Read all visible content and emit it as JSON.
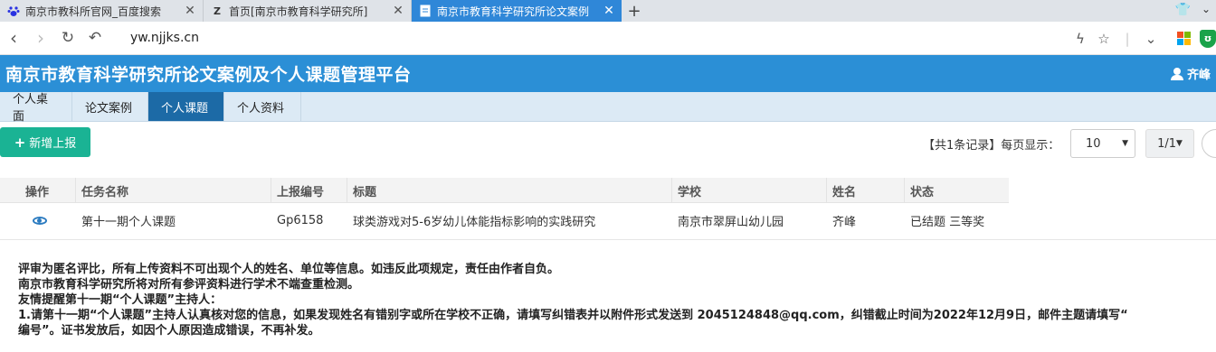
{
  "browser": {
    "tabs": [
      {
        "title": "南京市教科所官网_百度搜索",
        "icon": "baidu-paw-icon"
      },
      {
        "title": "首页[南京市教育科学研究所]",
        "icon": "z-logo-icon"
      },
      {
        "title": "南京市教育科学研究所论文案例",
        "icon": "document-icon",
        "active": true
      }
    ],
    "url": "yw.njjks.cn"
  },
  "app": {
    "title": "南京市教育科学研究所论文案例及个人课题管理平台",
    "user": "齐峰",
    "accent": "#2b8fd6"
  },
  "nav": {
    "tabs": [
      "个人桌面",
      "论文案例",
      "个人课题",
      "个人资料"
    ],
    "active": "个人课题"
  },
  "toolbar": {
    "add_label": "新增上报",
    "records": "【共1条记录】每页显示：",
    "page_size": "10",
    "page": "1/1"
  },
  "table": {
    "headers": [
      "操作",
      "任务名称",
      "上报编号",
      "标题",
      "学校",
      "姓名",
      "状态"
    ],
    "rows": [
      {
        "task": "第十一期个人课题",
        "code": "Gp6158",
        "title": "球类游戏对5-6岁幼儿体能指标影响的实践研究",
        "school": "南京市翠屏山幼儿园",
        "name": "齐峰",
        "status": "已结题 三等奖"
      }
    ]
  },
  "notice": {
    "line1": "评审为匿名评比，所有上传资料不可出现个人的姓名、单位等信息。如违反此项规定，责任由作者自负。",
    "line2": "南京市教育科学研究所将对所有参评资料进行学术不端查重检测。",
    "line3": "友情提醒第十一期“个人课题”主持人：",
    "line4": "1.请第十一期“个人课题”主持人认真核对您的信息，如果发现姓名有错别字或所在学校不正确，请填写纠错表并以附件形式发送到 2045124848@qq.com，纠错截止时间为2022年12月9日，邮件主题请填写“",
    "line5": "编号”。证书发放后，如因个人原因造成错误，不再补发。"
  }
}
